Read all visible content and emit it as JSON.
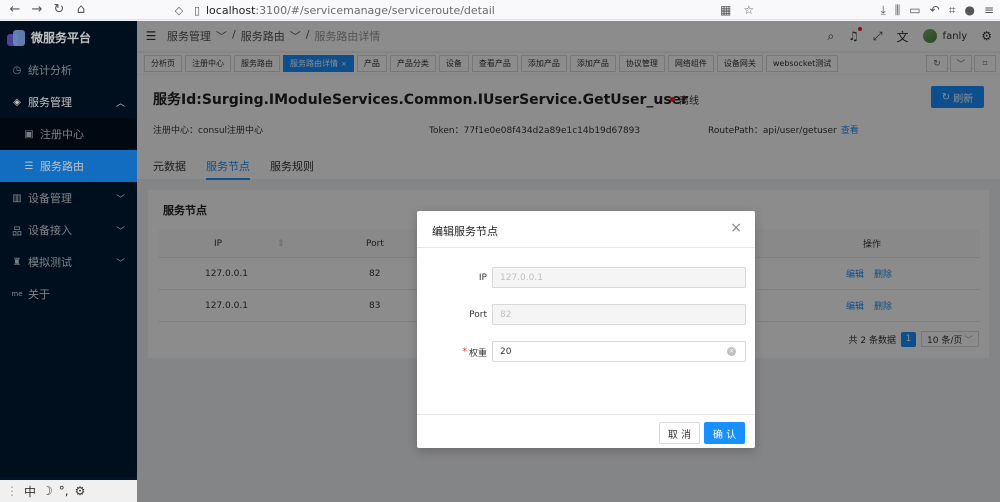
{
  "browser": {
    "url_host": "localhost",
    "url_path": ":3100/#/servicemanage/serviceroute/detail"
  },
  "sidebar": {
    "app_title": "微服务平台",
    "items": [
      {
        "label": "统计分析",
        "icon": "dashboard-icon"
      },
      {
        "label": "服务管理",
        "icon": "service-icon",
        "expanded": true
      },
      {
        "label": "注册中心",
        "icon": "registry-icon"
      },
      {
        "label": "服务路由",
        "icon": "route-icon",
        "active": true
      },
      {
        "label": "设备管理",
        "icon": "device-icon"
      },
      {
        "label": "设备接入",
        "icon": "access-icon"
      },
      {
        "label": "模拟测试",
        "icon": "test-icon"
      },
      {
        "label": "关于",
        "icon": "about-icon",
        "badge": "me"
      }
    ],
    "bottom_tools": {
      "lang": "中",
      "moon": "☽",
      "punct": "°,",
      "settings": "⚙"
    }
  },
  "header": {
    "breadcrumbs": [
      "服务管理",
      "服务路由",
      "服务路由详情"
    ],
    "user_name": "fanly"
  },
  "tabs": [
    {
      "label": "分析页"
    },
    {
      "label": "注册中心"
    },
    {
      "label": "服务路由"
    },
    {
      "label": "服务路由详情",
      "active": true
    },
    {
      "label": "产品"
    },
    {
      "label": "产品分类"
    },
    {
      "label": "设备"
    },
    {
      "label": "查看产品"
    },
    {
      "label": "添加产品"
    },
    {
      "label": "添加产品"
    },
    {
      "label": "协议管理"
    },
    {
      "label": "网络组件"
    },
    {
      "label": "设备网关"
    },
    {
      "label": "websocket测试"
    }
  ],
  "detail": {
    "title_prefix": "服务",
    "title_id": "Id:Surging.IModuleServices.Common.IUserService.GetUser_user",
    "status": "离线",
    "refresh_label": "刷新",
    "registry_label": "注册中心：consul注册中心",
    "token_label": "Token：77f1e0e08f434d2a89e1c14b19d67893",
    "route_label": "RoutePath：api/user/getuser",
    "view_link": "查看",
    "tabs": [
      "元数据",
      "服务节点",
      "服务规则"
    ]
  },
  "nodes": {
    "title": "服务节点",
    "columns": {
      "ip": "IP",
      "port": "Port",
      "action": "操作"
    },
    "rows": [
      {
        "ip": "127.0.0.1",
        "port": "82",
        "edit": "编辑",
        "delete": "删除"
      },
      {
        "ip": "127.0.0.1",
        "port": "83",
        "edit": "编辑",
        "delete": "删除"
      }
    ],
    "pager": {
      "total": "共 2 条数据",
      "page": "1",
      "page_size": "10 条/页"
    }
  },
  "modal": {
    "title": "编辑服务节点",
    "fields": {
      "ip": {
        "label": "IP",
        "value": "127.0.0.1"
      },
      "port": {
        "label": "Port",
        "value": "82"
      },
      "weight": {
        "label": "权重",
        "value": "20"
      }
    },
    "cancel": "取 消",
    "ok": "确 认"
  },
  "colors": {
    "primary": "#1890ff",
    "sidebar": "#001529",
    "danger": "#f5222d"
  }
}
